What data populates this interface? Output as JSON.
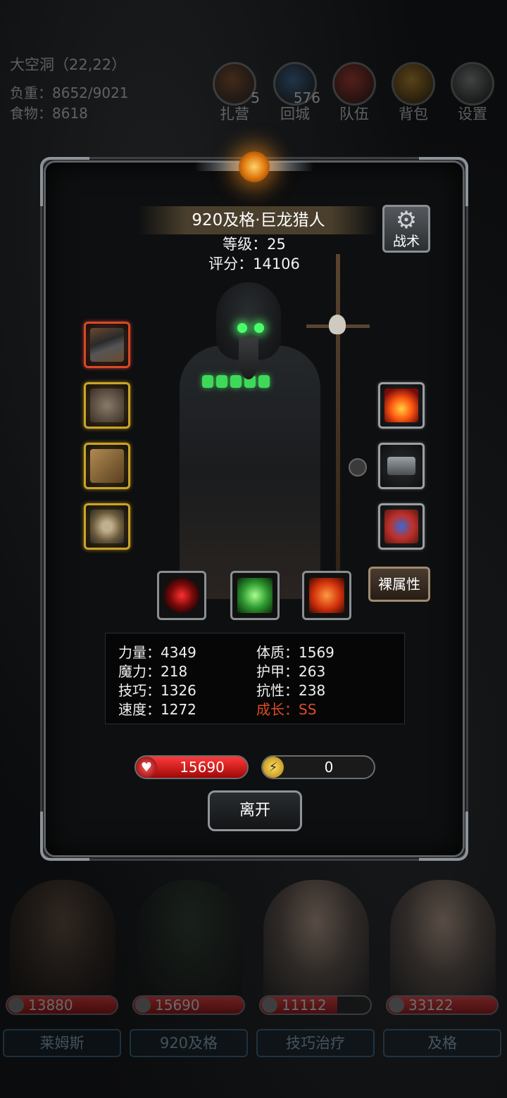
{
  "hud": {
    "location": "大空洞（22,22）",
    "load": "负重：8652/9021",
    "food": "食物：8618",
    "buttons": [
      {
        "label": "扎营",
        "badge": "5",
        "icon": "campfire-icon"
      },
      {
        "label": "回城",
        "badge": "576",
        "icon": "portal-icon"
      },
      {
        "label": "队伍",
        "badge": "",
        "icon": "banner-icon"
      },
      {
        "label": "背包",
        "badge": "",
        "icon": "chest-icon"
      },
      {
        "label": "设置",
        "badge": "",
        "icon": "gear-icon"
      }
    ]
  },
  "hero": {
    "name": "920及格·巨龙猎人",
    "level": "等级：25",
    "score": "评分：14106",
    "tactics_label": "战术",
    "naked_stats_label": "裸属性",
    "equipment_left": [
      {
        "name": "pistol-icon",
        "rarity": "red"
      },
      {
        "name": "armor-icon",
        "rarity": "gold"
      },
      {
        "name": "gauntlet-icon",
        "rarity": "gold"
      },
      {
        "name": "ring-icon",
        "rarity": "gold"
      }
    ],
    "equipment_right": [
      {
        "name": "fire-orb-icon"
      },
      {
        "name": "stone-icon"
      },
      {
        "name": "cloth-icon"
      }
    ],
    "skills": [
      "crosshair-skill-icon",
      "skull-skill-icon",
      "heal-cross-skill-icon"
    ]
  },
  "stats": {
    "strength": "力量：4349",
    "magic": "魔力：218",
    "skill": "技巧：1326",
    "speed": "速度：1272",
    "constitution": "体质：1569",
    "armor": "护甲：263",
    "resistance": "抗性：238",
    "growth": "成长：SS"
  },
  "bars": {
    "hp": "15690",
    "hp_fill": 1.0,
    "energy": "0",
    "energy_fill": 0.0
  },
  "leave_label": "离开",
  "party": [
    {
      "hp": "13880",
      "name": "莱姆斯",
      "fill": 1.0
    },
    {
      "hp": "15690",
      "name": "920及格",
      "fill": 1.0
    },
    {
      "hp": "11112",
      "name": "技巧治疗",
      "fill": 0.7
    },
    {
      "hp": "33122",
      "name": "及格",
      "fill": 1.0
    }
  ],
  "colors": {
    "growth": "#e04a24",
    "hp_red": "#d01818",
    "equip_red": "#d64a24",
    "equip_gold": "#c9a42a"
  }
}
